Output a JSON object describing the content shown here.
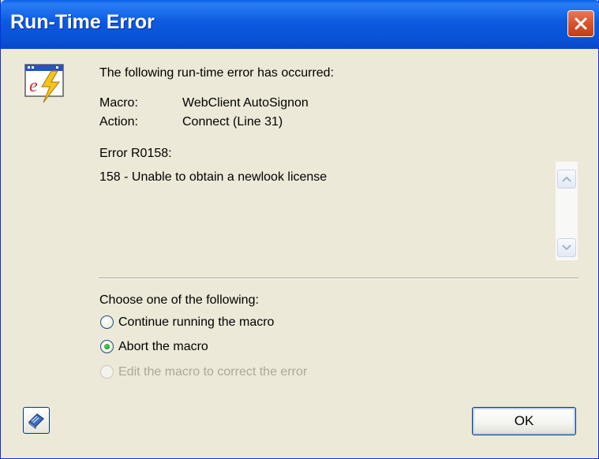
{
  "window": {
    "title": "Run-Time Error"
  },
  "message": {
    "heading": "The following run-time error has occurred:",
    "macro_label": "Macro:",
    "macro_value": "WebClient AutoSignon",
    "action_label": "Action:",
    "action_value": "Connect (Line 31)",
    "error_code": "Error R0158:",
    "error_text": "158 - Unable to obtain a newlook license"
  },
  "choices": {
    "prompt": "Choose one of the following:",
    "options": [
      {
        "label": "Continue running the macro",
        "selected": false,
        "enabled": true
      },
      {
        "label": "Abort the macro",
        "selected": true,
        "enabled": true
      },
      {
        "label": "Edit the macro to correct the error",
        "selected": false,
        "enabled": false
      }
    ]
  },
  "buttons": {
    "ok_label": "OK"
  },
  "icons": {
    "app": "macro-error-icon",
    "help": "help-book-icon",
    "close": "close-icon"
  },
  "colors": {
    "titlebar": "#0a52d6",
    "close_button": "#d8532d",
    "dialog_bg": "#ece9d8"
  }
}
